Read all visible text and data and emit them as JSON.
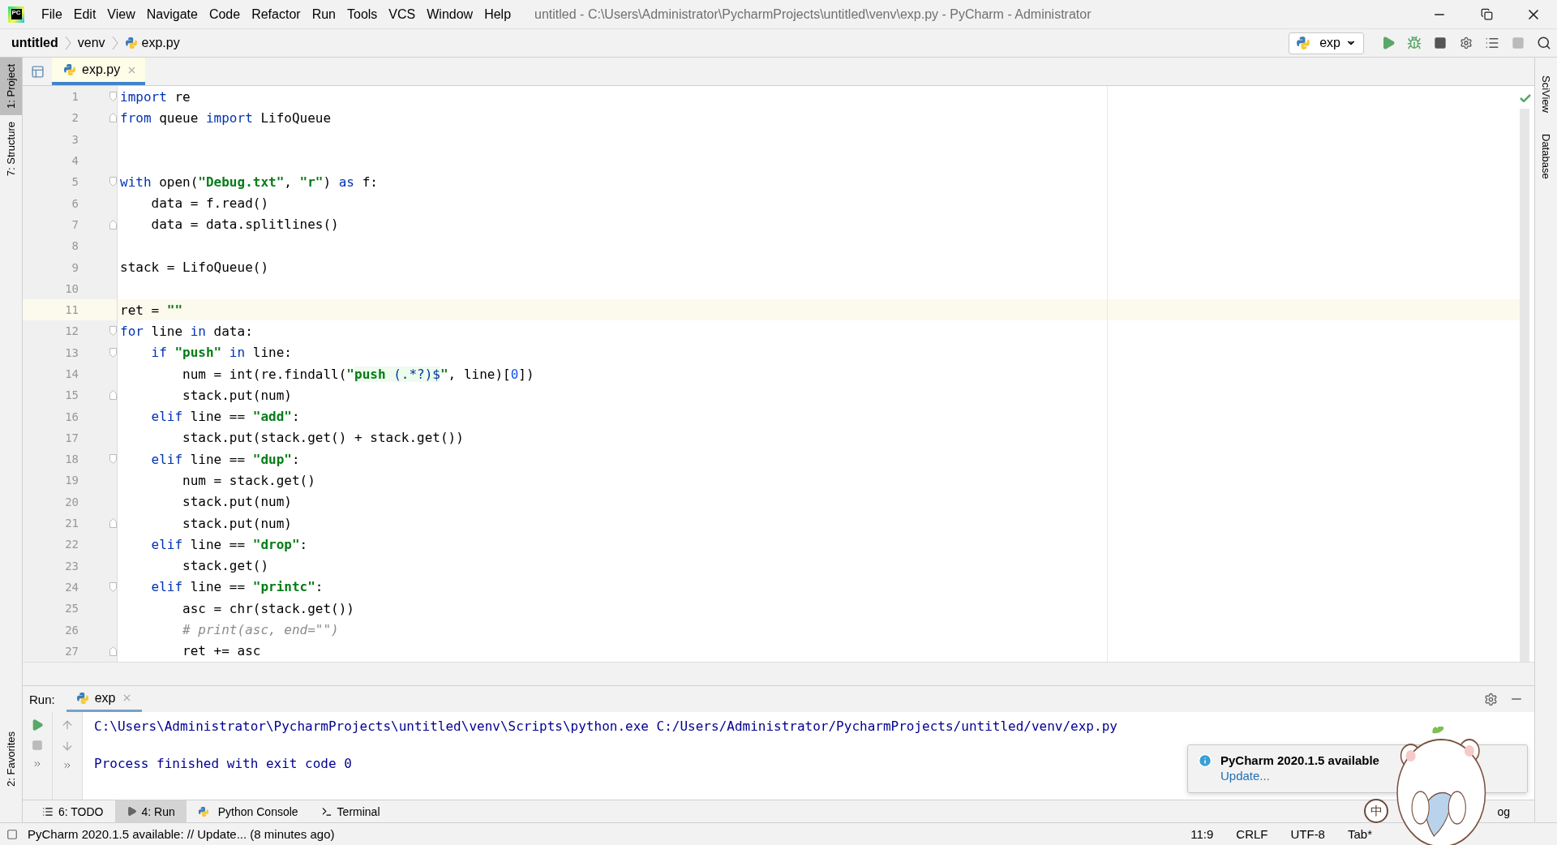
{
  "menu_bar": {
    "logo_text": "PC",
    "menus": [
      "File",
      "Edit",
      "View",
      "Navigate",
      "Code",
      "Refactor",
      "Run",
      "Tools",
      "VCS",
      "Window",
      "Help"
    ],
    "title": "untitled - C:\\Users\\Administrator\\PycharmProjects\\untitled\\venv\\exp.py - PyCharm - Administrator"
  },
  "breadcrumbs": [
    {
      "kind": "project",
      "label": "untitled"
    },
    {
      "kind": "folder",
      "label": "venv"
    },
    {
      "kind": "file",
      "label": "exp.py"
    }
  ],
  "run_config": {
    "label": "exp"
  },
  "left_stripe": [
    {
      "label": "1: Project",
      "selected": true
    },
    {
      "label": "7: Structure",
      "selected": false
    }
  ],
  "left_stripe_bottom": [
    {
      "label": "2: Favorites"
    }
  ],
  "right_stripe": [
    {
      "label": "SciView"
    },
    {
      "label": "Database"
    }
  ],
  "editor_tabs": [
    {
      "label": "exp.py",
      "selected": true
    }
  ],
  "code_lines": [
    {
      "n": "1",
      "fold": {
        "kind": "start"
      },
      "current": false,
      "tokens": [
        {
          "kind": "kw",
          "text": "import"
        },
        {
          "kind": "p",
          "text": " re"
        }
      ]
    },
    {
      "n": "2",
      "fold": {
        "kind": "end"
      },
      "current": false,
      "tokens": [
        {
          "kind": "kw",
          "text": "from"
        },
        {
          "kind": "p",
          "text": " queue "
        },
        {
          "kind": "kw",
          "text": "import"
        },
        {
          "kind": "p",
          "text": " LifoQueue"
        }
      ]
    },
    {
      "n": "3",
      "current": false
    },
    {
      "n": "4",
      "current": false
    },
    {
      "n": "5",
      "fold": {
        "kind": "start"
      },
      "current": false,
      "tokens": [
        {
          "kind": "kw",
          "text": "with"
        },
        {
          "kind": "p",
          "text": " open("
        },
        {
          "kind": "str",
          "text": "\"Debug.txt\""
        },
        {
          "kind": "p",
          "text": ", "
        },
        {
          "kind": "str",
          "text": "\"r\""
        },
        {
          "kind": "p",
          "text": ") "
        },
        {
          "kind": "kw",
          "text": "as"
        },
        {
          "kind": "p",
          "text": " f:"
        }
      ]
    },
    {
      "n": "6",
      "current": false,
      "tokens": [
        {
          "kind": "p",
          "text": "    data = f.read()"
        }
      ]
    },
    {
      "n": "7",
      "fold": {
        "kind": "end"
      },
      "current": false,
      "tokens": [
        {
          "kind": "p",
          "text": "    data = data.splitlines()"
        }
      ]
    },
    {
      "n": "8",
      "current": false
    },
    {
      "n": "9",
      "current": false,
      "tokens": [
        {
          "kind": "p",
          "text": "stack = LifoQueue()"
        }
      ]
    },
    {
      "n": "10",
      "current": false
    },
    {
      "n": "11",
      "current": true,
      "tokens": [
        {
          "kind": "p",
          "text": "ret = "
        },
        {
          "kind": "str",
          "text": "\"\""
        }
      ]
    },
    {
      "n": "12",
      "fold": {
        "kind": "start"
      },
      "current": false,
      "tokens": [
        {
          "kind": "kw",
          "text": "for"
        },
        {
          "kind": "p",
          "text": " line "
        },
        {
          "kind": "kw",
          "text": "in"
        },
        {
          "kind": "p",
          "text": " data:"
        }
      ]
    },
    {
      "n": "13",
      "fold": {
        "kind": "start"
      },
      "current": false,
      "tokens": [
        {
          "kind": "kw",
          "text": "    if "
        },
        {
          "kind": "str",
          "text": "\"push\""
        },
        {
          "kind": "kw",
          "text": " in"
        },
        {
          "kind": "p",
          "text": " line:"
        }
      ]
    },
    {
      "n": "14",
      "current": false,
      "tokens": [
        {
          "kind": "p",
          "text": "        num = int(re.findall("
        },
        {
          "kind": "str",
          "text": "\""
        },
        {
          "kind": "rx",
          "text": "push "
        },
        {
          "kind": "rxm",
          "text": "(.*?)$"
        },
        {
          "kind": "str",
          "text": "\""
        },
        {
          "kind": "p",
          "text": ", line)["
        },
        {
          "kind": "num",
          "text": "0"
        },
        {
          "kind": "p",
          "text": "])"
        }
      ]
    },
    {
      "n": "15",
      "fold": {
        "kind": "end"
      },
      "current": false,
      "tokens": [
        {
          "kind": "p",
          "text": "        stack.put(num)"
        }
      ]
    },
    {
      "n": "16",
      "current": false,
      "tokens": [
        {
          "kind": "kw",
          "text": "    elif"
        },
        {
          "kind": "p",
          "text": " line == "
        },
        {
          "kind": "str",
          "text": "\"add\""
        },
        {
          "kind": "p",
          "text": ":"
        }
      ]
    },
    {
      "n": "17",
      "current": false,
      "tokens": [
        {
          "kind": "p",
          "text": "        stack.put(stack.get() + stack.get())"
        }
      ]
    },
    {
      "n": "18",
      "fold": {
        "kind": "start"
      },
      "current": false,
      "tokens": [
        {
          "kind": "kw",
          "text": "    elif"
        },
        {
          "kind": "p",
          "text": " line == "
        },
        {
          "kind": "str",
          "text": "\"dup\""
        },
        {
          "kind": "p",
          "text": ":"
        }
      ]
    },
    {
      "n": "19",
      "current": false,
      "tokens": [
        {
          "kind": "p",
          "text": "        num = stack.get()"
        }
      ]
    },
    {
      "n": "20",
      "current": false,
      "tokens": [
        {
          "kind": "p",
          "text": "        stack.put(num)"
        }
      ]
    },
    {
      "n": "21",
      "fold": {
        "kind": "end"
      },
      "current": false,
      "tokens": [
        {
          "kind": "p",
          "text": "        stack.put(num)"
        }
      ]
    },
    {
      "n": "22",
      "current": false,
      "tokens": [
        {
          "kind": "kw",
          "text": "    elif"
        },
        {
          "kind": "p",
          "text": " line == "
        },
        {
          "kind": "str",
          "text": "\"drop\""
        },
        {
          "kind": "p",
          "text": ":"
        }
      ]
    },
    {
      "n": "23",
      "current": false,
      "tokens": [
        {
          "kind": "p",
          "text": "        stack.get()"
        }
      ]
    },
    {
      "n": "24",
      "fold": {
        "kind": "start"
      },
      "current": false,
      "tokens": [
        {
          "kind": "kw",
          "text": "    elif"
        },
        {
          "kind": "p",
          "text": " line == "
        },
        {
          "kind": "str",
          "text": "\"printc\""
        },
        {
          "kind": "p",
          "text": ":"
        }
      ]
    },
    {
      "n": "25",
      "current": false,
      "tokens": [
        {
          "kind": "p",
          "text": "        asc = chr(stack.get())"
        }
      ]
    },
    {
      "n": "26",
      "current": false,
      "tokens": [
        {
          "kind": "cm",
          "text": "        # print(asc, end=\"\")"
        }
      ]
    },
    {
      "n": "27",
      "fold": {
        "kind": "end"
      },
      "current": false,
      "tokens": [
        {
          "kind": "p",
          "text": "        ret += asc"
        }
      ]
    }
  ],
  "run_panel": {
    "title": "Run:",
    "tabs": [
      {
        "label": "exp",
        "selected": true
      }
    ],
    "output": [
      {
        "kind": "command",
        "text": "C:\\Users\\Administrator\\PycharmProjects\\untitled\\venv\\Scripts\\python.exe C:/Users/Administrator/PycharmProjects/untitled/venv/exp.py"
      },
      {
        "kind": "result",
        "text": "Process finished with exit code 0"
      }
    ]
  },
  "notification": {
    "title": "PyCharm 2020.1.5 available",
    "link": "Update..."
  },
  "tool_window_bar": {
    "tabs": [
      {
        "kind": "todo",
        "label": "6: TODO",
        "selected": false
      },
      {
        "kind": "run",
        "label": "4: Run",
        "selected": true
      },
      {
        "kind": "console",
        "label": "Python Console",
        "selected": false
      },
      {
        "kind": "terminal",
        "label": "Terminal",
        "selected": false
      }
    ],
    "right": "og"
  },
  "ime_badge": "中",
  "status_bar": {
    "message": "PyCharm 2020.1.5 available: // Update... (8 minutes ago)",
    "items": [
      "11:9",
      "CRLF",
      "UTF-8",
      "Tab*"
    ]
  }
}
